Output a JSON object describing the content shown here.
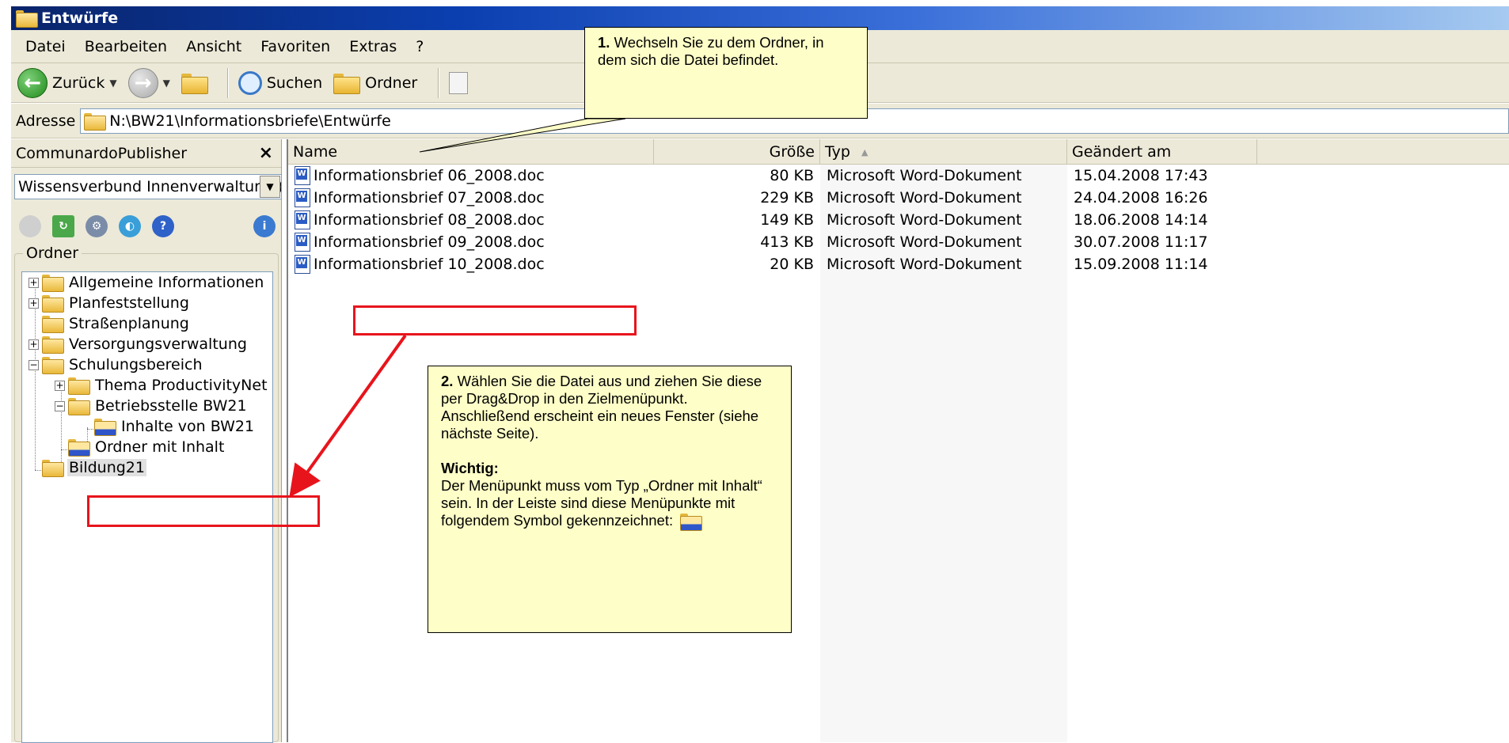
{
  "window": {
    "title": "Entwürfe"
  },
  "menu": [
    "Datei",
    "Bearbeiten",
    "Ansicht",
    "Favoriten",
    "Extras",
    "?"
  ],
  "toolbar": {
    "back_label": "Zurück",
    "search_label": "Suchen",
    "folders_label": "Ordner"
  },
  "address": {
    "label": "Adresse",
    "path": "N:\\BW21\\Informationsbriefe\\Entwürfe"
  },
  "left_pane": {
    "title": "CommunardoPublisher",
    "close_label": "×",
    "selector_value": "Wissensverbund Innenverwaltung (Inte",
    "folder_group_label": "Ordner",
    "tree": [
      "Allgemeine Informationen",
      "Planfeststellung",
      "Straßenplanung",
      "Versorgungsverwaltung",
      "Schulungsbereich",
      "Thema ProductivityNet",
      "Betriebsstelle BW21",
      "Inhalte von BW21",
      "Ordner mit Inhalt",
      "Bildung21"
    ]
  },
  "file_list": {
    "columns": [
      "Name",
      "Größe",
      "Typ",
      "Geändert am"
    ],
    "sort_indicator": "▲",
    "rows": [
      {
        "name": "Informationsbrief 06_2008.doc",
        "size": "80 KB",
        "type": "Microsoft Word-Dokument",
        "modified": "15.04.2008 17:43"
      },
      {
        "name": "Informationsbrief 07_2008.doc",
        "size": "229 KB",
        "type": "Microsoft Word-Dokument",
        "modified": "24.04.2008 16:26"
      },
      {
        "name": "Informationsbrief 08_2008.doc",
        "size": "149 KB",
        "type": "Microsoft Word-Dokument",
        "modified": "18.06.2008 14:14"
      },
      {
        "name": "Informationsbrief 09_2008.doc",
        "size": "413 KB",
        "type": "Microsoft Word-Dokument",
        "modified": "30.07.2008 11:17"
      },
      {
        "name": "Informationsbrief 10_2008.doc",
        "size": "20 KB",
        "type": "Microsoft Word-Dokument",
        "modified": "15.09.2008 11:14"
      }
    ]
  },
  "callouts": {
    "step1_bold": "1.",
    "step1_text": " Wechseln Sie zu dem Ordner, in dem sich die Datei befindet.",
    "step2_bold": "2.",
    "step2_text": " Wählen Sie die Datei aus und ziehen Sie diese per Drag&Drop in den Zielmenüpunkt. Anschließend erscheint ein neues Fenster (siehe nächste Seite).",
    "important_heading": "Wichtig:",
    "important_text": "Der Menüpunkt muss vom Typ „Ordner mit Inhalt“ sein. In der Leiste sind diese Menüpunkte mit folgendem Symbol gekennzeichnet:"
  },
  "colors": {
    "highlight_red": "#e8141c",
    "callout_bg": "#fefec8",
    "titlebar": "#0b3fb0"
  }
}
